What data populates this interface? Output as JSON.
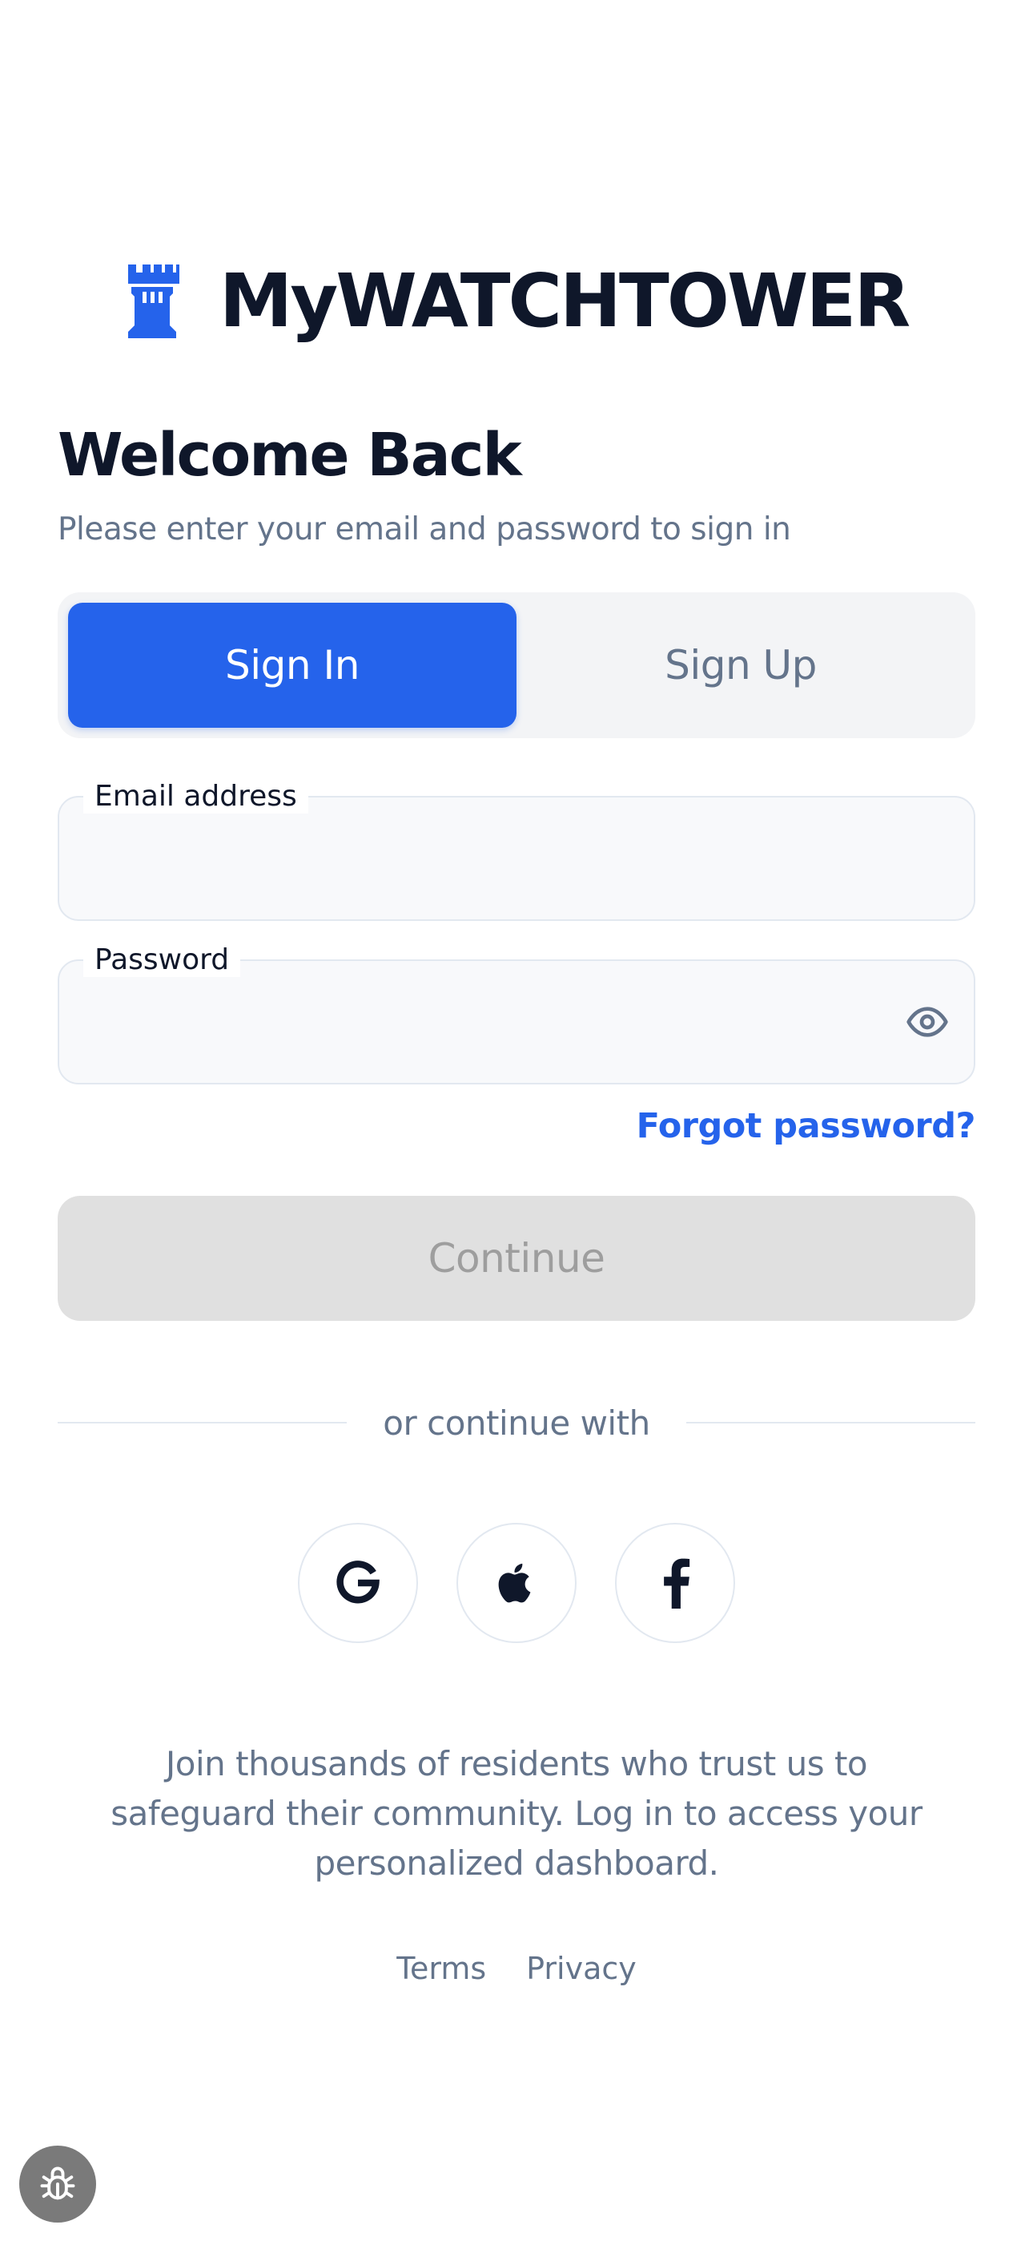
{
  "brand": {
    "name": "MyWATCHTOWER",
    "logo_icon": "tower-icon",
    "accent_color": "#2563eb"
  },
  "header": {
    "title": "Welcome Back",
    "subtitle": "Please enter your email and password to sign in"
  },
  "tabs": [
    {
      "label": "Sign In",
      "active": true
    },
    {
      "label": "Sign Up",
      "active": false
    }
  ],
  "form": {
    "email": {
      "label": "Email address",
      "value": "",
      "placeholder": ""
    },
    "password": {
      "label": "Password",
      "value": "",
      "placeholder": "",
      "toggle_icon": "eye-icon"
    },
    "forgot_label": "Forgot password?",
    "submit_label": "Continue",
    "submit_enabled": false
  },
  "divider_text": "or continue with",
  "socials": [
    {
      "name": "google",
      "icon": "google-icon"
    },
    {
      "name": "apple",
      "icon": "apple-icon"
    },
    {
      "name": "facebook",
      "icon": "facebook-icon"
    }
  ],
  "blurb": "Join thousands of residents who trust us to safeguard their community. Log in to access your personalized dashboard.",
  "footer_links": {
    "terms": "Terms",
    "privacy": "Privacy"
  },
  "debug": {
    "icon": "bug-icon"
  }
}
